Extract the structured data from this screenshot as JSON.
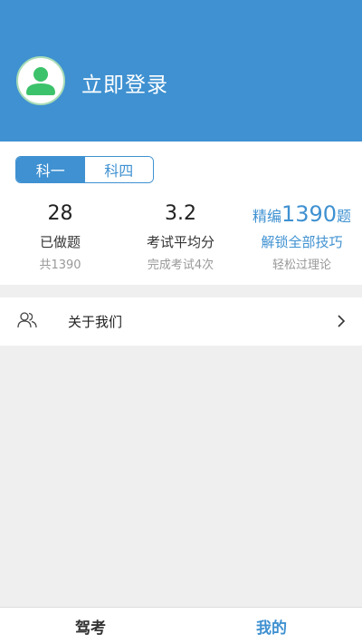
{
  "header": {
    "login_label": "立即登录",
    "avatar_icon": "user-avatar-icon",
    "bg_color": "#3f91d1"
  },
  "subject_tabs": [
    {
      "label": "科一",
      "active": true
    },
    {
      "label": "科四",
      "active": false
    }
  ],
  "stats": {
    "done": {
      "value": "28",
      "label": "已做题",
      "sub": "共1390"
    },
    "avg": {
      "value": "3.2",
      "label": "考试平均分",
      "sub": "完成考试4次"
    },
    "promo": {
      "prefix": "精编",
      "count": "1390",
      "suffix": "题",
      "label": "解锁全部技巧",
      "sub": "轻松过理论"
    }
  },
  "menu": {
    "about": {
      "label": "关于我们",
      "icon": "users-icon",
      "chevron": "chevron-right-icon"
    }
  },
  "tabbar": [
    {
      "label": "驾考",
      "active": false
    },
    {
      "label": "我的",
      "active": true
    }
  ],
  "colors": {
    "accent": "#3f91d1",
    "avatar_green": "#3cc26a"
  }
}
